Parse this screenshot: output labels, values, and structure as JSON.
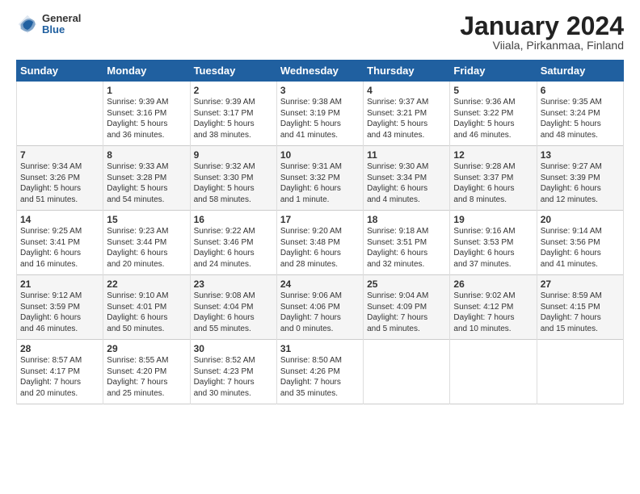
{
  "header": {
    "title": "January 2024",
    "subtitle": "Viiala, Pirkanmaa, Finland",
    "logo_general": "General",
    "logo_blue": "Blue"
  },
  "weekdays": [
    "Sunday",
    "Monday",
    "Tuesday",
    "Wednesday",
    "Thursday",
    "Friday",
    "Saturday"
  ],
  "weeks": [
    [
      {
        "day": "",
        "info": ""
      },
      {
        "day": "1",
        "info": "Sunrise: 9:39 AM\nSunset: 3:16 PM\nDaylight: 5 hours\nand 36 minutes."
      },
      {
        "day": "2",
        "info": "Sunrise: 9:39 AM\nSunset: 3:17 PM\nDaylight: 5 hours\nand 38 minutes."
      },
      {
        "day": "3",
        "info": "Sunrise: 9:38 AM\nSunset: 3:19 PM\nDaylight: 5 hours\nand 41 minutes."
      },
      {
        "day": "4",
        "info": "Sunrise: 9:37 AM\nSunset: 3:21 PM\nDaylight: 5 hours\nand 43 minutes."
      },
      {
        "day": "5",
        "info": "Sunrise: 9:36 AM\nSunset: 3:22 PM\nDaylight: 5 hours\nand 46 minutes."
      },
      {
        "day": "6",
        "info": "Sunrise: 9:35 AM\nSunset: 3:24 PM\nDaylight: 5 hours\nand 48 minutes."
      }
    ],
    [
      {
        "day": "7",
        "info": "Sunrise: 9:34 AM\nSunset: 3:26 PM\nDaylight: 5 hours\nand 51 minutes."
      },
      {
        "day": "8",
        "info": "Sunrise: 9:33 AM\nSunset: 3:28 PM\nDaylight: 5 hours\nand 54 minutes."
      },
      {
        "day": "9",
        "info": "Sunrise: 9:32 AM\nSunset: 3:30 PM\nDaylight: 5 hours\nand 58 minutes."
      },
      {
        "day": "10",
        "info": "Sunrise: 9:31 AM\nSunset: 3:32 PM\nDaylight: 6 hours\nand 1 minute."
      },
      {
        "day": "11",
        "info": "Sunrise: 9:30 AM\nSunset: 3:34 PM\nDaylight: 6 hours\nand 4 minutes."
      },
      {
        "day": "12",
        "info": "Sunrise: 9:28 AM\nSunset: 3:37 PM\nDaylight: 6 hours\nand 8 minutes."
      },
      {
        "day": "13",
        "info": "Sunrise: 9:27 AM\nSunset: 3:39 PM\nDaylight: 6 hours\nand 12 minutes."
      }
    ],
    [
      {
        "day": "14",
        "info": "Sunrise: 9:25 AM\nSunset: 3:41 PM\nDaylight: 6 hours\nand 16 minutes."
      },
      {
        "day": "15",
        "info": "Sunrise: 9:23 AM\nSunset: 3:44 PM\nDaylight: 6 hours\nand 20 minutes."
      },
      {
        "day": "16",
        "info": "Sunrise: 9:22 AM\nSunset: 3:46 PM\nDaylight: 6 hours\nand 24 minutes."
      },
      {
        "day": "17",
        "info": "Sunrise: 9:20 AM\nSunset: 3:48 PM\nDaylight: 6 hours\nand 28 minutes."
      },
      {
        "day": "18",
        "info": "Sunrise: 9:18 AM\nSunset: 3:51 PM\nDaylight: 6 hours\nand 32 minutes."
      },
      {
        "day": "19",
        "info": "Sunrise: 9:16 AM\nSunset: 3:53 PM\nDaylight: 6 hours\nand 37 minutes."
      },
      {
        "day": "20",
        "info": "Sunrise: 9:14 AM\nSunset: 3:56 PM\nDaylight: 6 hours\nand 41 minutes."
      }
    ],
    [
      {
        "day": "21",
        "info": "Sunrise: 9:12 AM\nSunset: 3:59 PM\nDaylight: 6 hours\nand 46 minutes."
      },
      {
        "day": "22",
        "info": "Sunrise: 9:10 AM\nSunset: 4:01 PM\nDaylight: 6 hours\nand 50 minutes."
      },
      {
        "day": "23",
        "info": "Sunrise: 9:08 AM\nSunset: 4:04 PM\nDaylight: 6 hours\nand 55 minutes."
      },
      {
        "day": "24",
        "info": "Sunrise: 9:06 AM\nSunset: 4:06 PM\nDaylight: 7 hours\nand 0 minutes."
      },
      {
        "day": "25",
        "info": "Sunrise: 9:04 AM\nSunset: 4:09 PM\nDaylight: 7 hours\nand 5 minutes."
      },
      {
        "day": "26",
        "info": "Sunrise: 9:02 AM\nSunset: 4:12 PM\nDaylight: 7 hours\nand 10 minutes."
      },
      {
        "day": "27",
        "info": "Sunrise: 8:59 AM\nSunset: 4:15 PM\nDaylight: 7 hours\nand 15 minutes."
      }
    ],
    [
      {
        "day": "28",
        "info": "Sunrise: 8:57 AM\nSunset: 4:17 PM\nDaylight: 7 hours\nand 20 minutes."
      },
      {
        "day": "29",
        "info": "Sunrise: 8:55 AM\nSunset: 4:20 PM\nDaylight: 7 hours\nand 25 minutes."
      },
      {
        "day": "30",
        "info": "Sunrise: 8:52 AM\nSunset: 4:23 PM\nDaylight: 7 hours\nand 30 minutes."
      },
      {
        "day": "31",
        "info": "Sunrise: 8:50 AM\nSunset: 4:26 PM\nDaylight: 7 hours\nand 35 minutes."
      },
      {
        "day": "",
        "info": ""
      },
      {
        "day": "",
        "info": ""
      },
      {
        "day": "",
        "info": ""
      }
    ]
  ]
}
